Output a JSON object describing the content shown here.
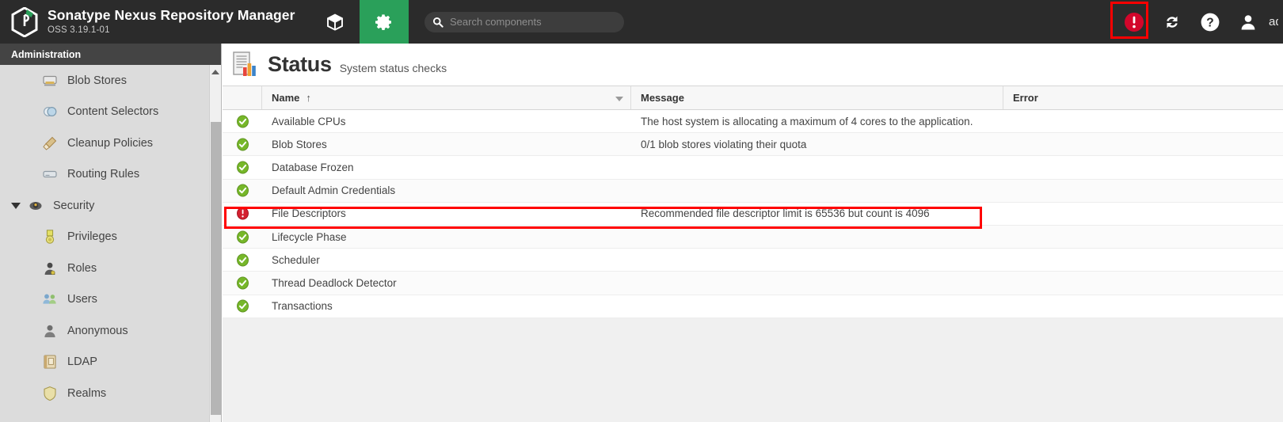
{
  "header": {
    "brand_title": "Sonatype Nexus Repository Manager",
    "brand_version": "OSS 3.19.1-01",
    "logo_icon": "nexus-hexagon-logo",
    "browse_icon": "box-cube-icon",
    "admin_icon": "gear-icon",
    "search": {
      "icon": "search-icon",
      "value": "",
      "placeholder": "Search components"
    },
    "icons": [
      {
        "name": "alert-error-icon",
        "glyph": "!"
      },
      {
        "name": "refresh-icon",
        "glyph": "↻"
      },
      {
        "name": "help-icon",
        "glyph": "?"
      },
      {
        "name": "user-account-icon",
        "glyph": "👤"
      }
    ],
    "username": "admin"
  },
  "sidebar": {
    "section_title": "Administration",
    "items": [
      {
        "label": "Blob Stores",
        "icon": "blob-stores-icon",
        "level": 1,
        "expandable": false
      },
      {
        "label": "Content Selectors",
        "icon": "content-selectors-icon",
        "level": 1,
        "expandable": false
      },
      {
        "label": "Cleanup Policies",
        "icon": "cleanup-policies-icon",
        "level": 1,
        "expandable": false
      },
      {
        "label": "Routing Rules",
        "icon": "routing-rules-icon",
        "level": 1,
        "expandable": false
      },
      {
        "label": "Security",
        "icon": "security-icon",
        "level": 0,
        "expandable": true
      },
      {
        "label": "Privileges",
        "icon": "privileges-icon",
        "level": 1,
        "expandable": false
      },
      {
        "label": "Roles",
        "icon": "roles-icon",
        "level": 1,
        "expandable": false
      },
      {
        "label": "Users",
        "icon": "users-icon",
        "level": 1,
        "expandable": false
      },
      {
        "label": "Anonymous",
        "icon": "anonymous-icon",
        "level": 1,
        "expandable": false
      },
      {
        "label": "LDAP",
        "icon": "ldap-icon",
        "level": 1,
        "expandable": false
      },
      {
        "label": "Realms",
        "icon": "realms-icon",
        "level": 1,
        "expandable": false
      }
    ]
  },
  "main": {
    "page_icon": "status-report-icon",
    "title": "Status",
    "subtitle": "System status checks",
    "columns": {
      "status": "",
      "name": "Name",
      "message": "Message",
      "error": "Error"
    },
    "sort": {
      "column": "Name",
      "direction": "asc",
      "arrow": "↑"
    },
    "rows": [
      {
        "status": "ok",
        "name": "Available CPUs",
        "message": "The host system is allocating a maximum of 4 cores to the application.",
        "error": ""
      },
      {
        "status": "ok",
        "name": "Blob Stores",
        "message": "0/1 blob stores violating their quota",
        "error": ""
      },
      {
        "status": "ok",
        "name": "Database Frozen",
        "message": "",
        "error": ""
      },
      {
        "status": "ok",
        "name": "Default Admin Credentials",
        "message": "",
        "error": ""
      },
      {
        "status": "error",
        "name": "File Descriptors",
        "message": "Recommended file descriptor limit is 65536 but count is 4096",
        "error": ""
      },
      {
        "status": "ok",
        "name": "Lifecycle Phase",
        "message": "",
        "error": ""
      },
      {
        "status": "ok",
        "name": "Scheduler",
        "message": "",
        "error": ""
      },
      {
        "status": "ok",
        "name": "Thread Deadlock Detector",
        "message": "",
        "error": ""
      },
      {
        "status": "ok",
        "name": "Transactions",
        "message": "",
        "error": ""
      }
    ]
  },
  "annotations": [
    {
      "name": "alert-icon-highlight",
      "color": "#ff0000"
    },
    {
      "name": "file-descriptors-row-highlight",
      "color": "#ff0000"
    }
  ],
  "colors": {
    "header_bg": "#2b2b2b",
    "accent_green": "#2aa05a",
    "sidebar_bg": "#dcdcdc",
    "status_ok": "#76b729",
    "status_error": "#d32030",
    "annotation": "#ff0000"
  }
}
